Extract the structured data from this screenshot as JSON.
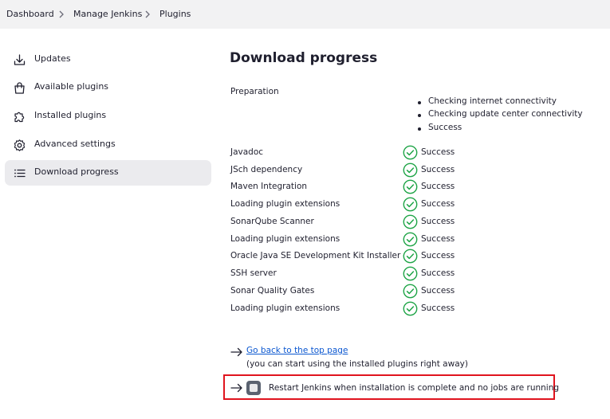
{
  "breadcrumb": [
    {
      "label": "Dashboard"
    },
    {
      "label": "Manage Jenkins"
    },
    {
      "label": "Plugins"
    }
  ],
  "sidebar": {
    "items": [
      {
        "label": "Updates",
        "icon": "download-icon",
        "active": false
      },
      {
        "label": "Available plugins",
        "icon": "shopping-bag-icon",
        "active": false
      },
      {
        "label": "Installed plugins",
        "icon": "puzzle-icon",
        "active": false
      },
      {
        "label": "Advanced settings",
        "icon": "gear-icon",
        "active": false
      },
      {
        "label": "Download progress",
        "icon": "list-icon",
        "active": true
      }
    ]
  },
  "main": {
    "title": "Download progress",
    "preparation": {
      "label": "Preparation",
      "steps": [
        "Checking internet connectivity",
        "Checking update center connectivity",
        "Success"
      ]
    },
    "plugins": [
      {
        "name": "Javadoc",
        "status": "Success"
      },
      {
        "name": "JSch dependency",
        "status": "Success"
      },
      {
        "name": "Maven Integration",
        "status": "Success"
      },
      {
        "name": "Loading plugin extensions",
        "status": "Success"
      },
      {
        "name": "SonarQube Scanner",
        "status": "Success"
      },
      {
        "name": "Loading plugin extensions",
        "status": "Success"
      },
      {
        "name": "Oracle Java SE Development Kit Installer",
        "status": "Success"
      },
      {
        "name": "SSH server",
        "status": "Success"
      },
      {
        "name": "Sonar Quality Gates",
        "status": "Success"
      },
      {
        "name": "Loading plugin extensions",
        "status": "Success"
      }
    ],
    "back_link": "Go back to the top page",
    "back_hint": "(you can start using the installed plugins right away)",
    "restart_label": "Restart Jenkins when installation is complete and no jobs are running",
    "restart_checked": false
  },
  "colors": {
    "success": "#1ea446",
    "link": "#0b57d0",
    "highlight": "#e0141e",
    "active_item": "#ebebee"
  }
}
